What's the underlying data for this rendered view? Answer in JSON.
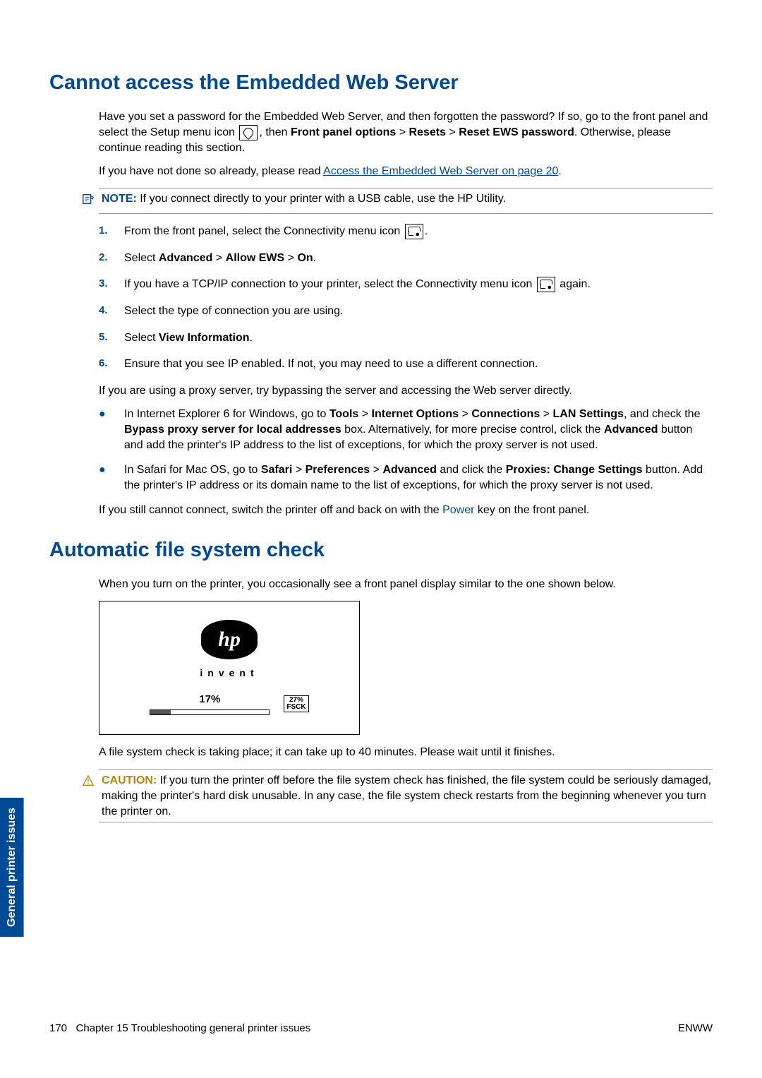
{
  "section1": {
    "title": "Cannot access the Embedded Web Server",
    "intro_a": "Have you set a password for the Embedded Web Server, and then forgotten the password? If so, go to the front panel and select the Setup menu icon ",
    "intro_b": ", then ",
    "fpo": "Front panel options",
    "gt": ">",
    "resets": "Resets",
    "reset_ews": "Reset EWS password",
    "intro_c": ". Otherwise, please continue reading this section.",
    "read_a": "If you have not done so already, please read ",
    "read_link": "Access the Embedded Web Server on page 20",
    "read_b": ".",
    "note_label": "NOTE:",
    "note_text": "If you connect directly to your printer with a USB cable, use the HP Utility.",
    "steps": {
      "s1a": "From the front panel, select the Connectivity menu icon ",
      "s1b": ".",
      "s2a": "Select ",
      "s2_adv": "Advanced",
      "s2_allow": "Allow EWS",
      "s2_on": "On",
      "s2b": ".",
      "s3a": "If you have a TCP/IP connection to your printer, select the Connectivity menu icon ",
      "s3b": " again.",
      "s4": "Select the type of connection you are using.",
      "s5a": "Select ",
      "s5_vi": "View Information",
      "s5b": ".",
      "s6": "Ensure that you see IP enabled. If not, you may need to use a different connection."
    },
    "proxy_intro": "If you are using a proxy server, try bypassing the server and accessing the Web server directly.",
    "ie_a": "In Internet Explorer 6 for Windows, go to ",
    "ie_tools": "Tools",
    "ie_io": "Internet Options",
    "ie_conn": "Connections",
    "ie_lan": "LAN Settings",
    "ie_b": ", and check the ",
    "ie_bypass": "Bypass proxy server for local addresses",
    "ie_c": " box. Alternatively, for more precise control, click the ",
    "ie_adv": "Advanced",
    "ie_d": " button and add the printer's IP address to the list of exceptions, for which the proxy server is not used.",
    "sf_a": "In Safari for Mac OS, go to ",
    "sf_safari": "Safari",
    "sf_prefs": "Preferences",
    "sf_adv": "Advanced",
    "sf_b": " and click the ",
    "sf_proxies": "Proxies: Change Settings",
    "sf_c": " button. Add the printer's IP address or its domain name to the list of exceptions, for which the proxy server is not used.",
    "still_a": "If you still cannot connect, switch the printer off and back on with the ",
    "still_power": "Power",
    "still_b": " key on the front panel."
  },
  "section2": {
    "title": "Automatic file system check",
    "intro": "When you turn on the printer, you occasionally see a front panel display similar to the one shown below.",
    "panel_invent": "invent",
    "panel_pct": "17%",
    "panel_fsck1": "27%",
    "panel_fsck2": "FSCK",
    "after": "A file system check is taking place; it can take up to 40 minutes. Please wait until it finishes.",
    "caution_label": "CAUTION:",
    "caution_text": "If you turn the printer off before the file system check has finished, the file system could be seriously damaged, making the printer's hard disk unusable. In any case, the file system check restarts from the beginning whenever you turn the printer on."
  },
  "sidebar": "General printer issues",
  "footer": {
    "page": "170",
    "chapter": "Chapter 15   Troubleshooting general printer issues",
    "right": "ENWW"
  },
  "nums": {
    "n1": "1.",
    "n2": "2.",
    "n3": "3.",
    "n4": "4.",
    "n5": "5.",
    "n6": "6."
  }
}
